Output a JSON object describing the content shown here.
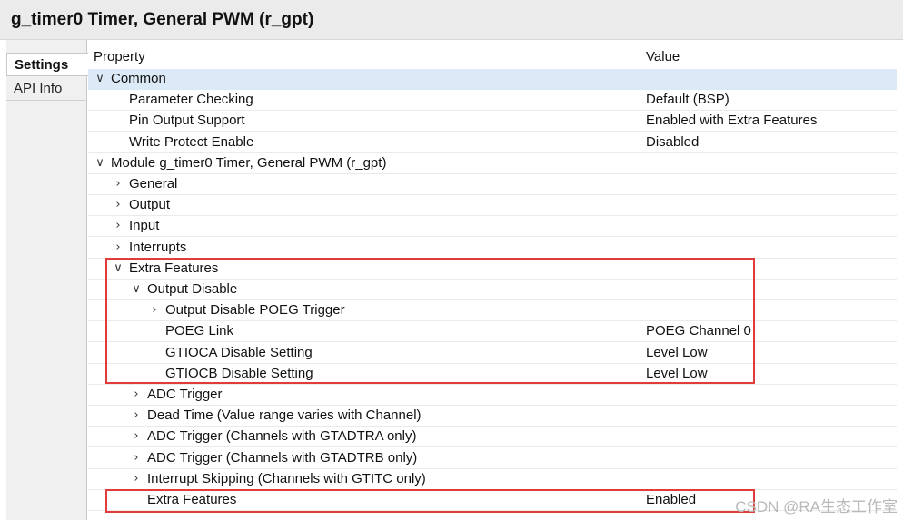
{
  "window": {
    "title": "g_timer0 Timer, General PWM (r_gpt)"
  },
  "tabs": [
    {
      "label": "Settings",
      "active": true
    },
    {
      "label": "API Info",
      "active": false
    }
  ],
  "columns": {
    "property": "Property",
    "value": "Value"
  },
  "rows": [
    {
      "property": "Common",
      "value": "",
      "indent": 0,
      "chevron": "expanded",
      "selected": true
    },
    {
      "property": "Parameter Checking",
      "value": "Default (BSP)",
      "indent": 1,
      "chevron": "none"
    },
    {
      "property": "Pin Output Support",
      "value": "Enabled with Extra Features",
      "indent": 1,
      "chevron": "none"
    },
    {
      "property": "Write Protect Enable",
      "value": "Disabled",
      "indent": 1,
      "chevron": "none"
    },
    {
      "property": "Module g_timer0 Timer, General PWM (r_gpt)",
      "value": "",
      "indent": 0,
      "chevron": "expanded"
    },
    {
      "property": "General",
      "value": "",
      "indent": 1,
      "chevron": "collapsed"
    },
    {
      "property": "Output",
      "value": "",
      "indent": 1,
      "chevron": "collapsed"
    },
    {
      "property": "Input",
      "value": "",
      "indent": 1,
      "chevron": "collapsed"
    },
    {
      "property": "Interrupts",
      "value": "",
      "indent": 1,
      "chevron": "collapsed"
    },
    {
      "property": "Extra Features",
      "value": "",
      "indent": 1,
      "chevron": "expanded"
    },
    {
      "property": "Output Disable",
      "value": "",
      "indent": 2,
      "chevron": "expanded"
    },
    {
      "property": "Output Disable POEG Trigger",
      "value": "",
      "indent": 3,
      "chevron": "collapsed"
    },
    {
      "property": "POEG Link",
      "value": "POEG Channel 0",
      "indent": 3,
      "chevron": "none"
    },
    {
      "property": "GTIOCA Disable Setting",
      "value": "Level Low",
      "indent": 3,
      "chevron": "none"
    },
    {
      "property": "GTIOCB Disable Setting",
      "value": "Level Low",
      "indent": 3,
      "chevron": "none"
    },
    {
      "property": "ADC Trigger",
      "value": "",
      "indent": 2,
      "chevron": "collapsed"
    },
    {
      "property": "Dead Time (Value range varies with Channel)",
      "value": "",
      "indent": 2,
      "chevron": "collapsed"
    },
    {
      "property": "ADC Trigger (Channels with GTADTRA only)",
      "value": "",
      "indent": 2,
      "chevron": "collapsed"
    },
    {
      "property": "ADC Trigger (Channels with GTADTRB only)",
      "value": "",
      "indent": 2,
      "chevron": "collapsed"
    },
    {
      "property": "Interrupt Skipping (Channels with GTITC only)",
      "value": "",
      "indent": 2,
      "chevron": "collapsed"
    },
    {
      "property": "Extra Features",
      "value": "Enabled",
      "indent": 2,
      "chevron": "none"
    }
  ],
  "icons": {
    "expanded": "chevron-down-icon",
    "collapsed": "chevron-right-icon"
  },
  "colors": {
    "highlight_box": "#e23b3b",
    "selected_row": "#dbeaf6"
  },
  "watermark": "CSDN @RA生态工作室"
}
